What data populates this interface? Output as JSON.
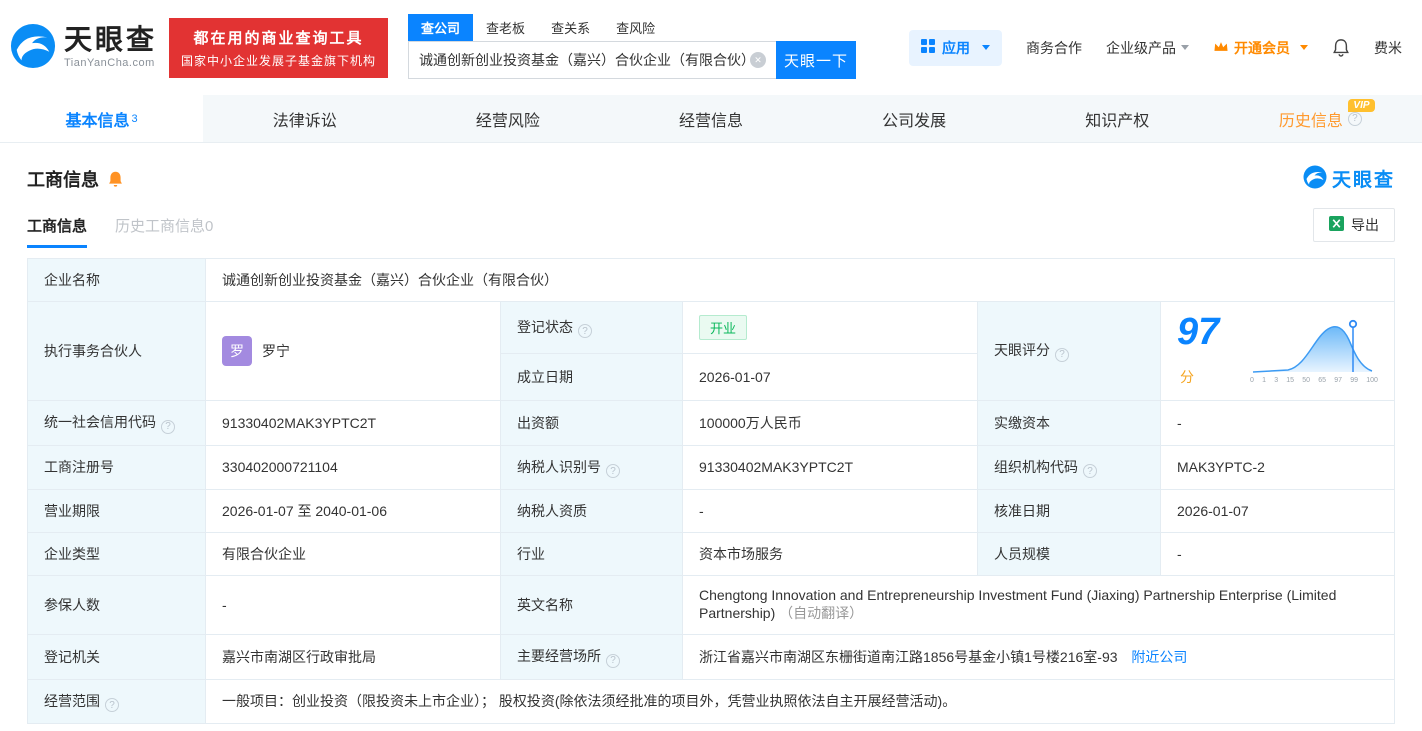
{
  "header": {
    "logo": {
      "name": "天眼查",
      "domain": "TianYanCha.com"
    },
    "banner": {
      "line1": "都在用的商业查询工具",
      "line2": "国家中小企业发展子基金旗下机构"
    },
    "search": {
      "tabs": [
        {
          "label": "查公司"
        },
        {
          "label": "查老板"
        },
        {
          "label": "查关系"
        },
        {
          "label": "查风险"
        }
      ],
      "value": "诚通创新创业投资基金（嘉兴）合伙企业（有限合伙）",
      "button": "天眼一下"
    },
    "menu": {
      "app": "应用",
      "cooperation": "商务合作",
      "enterprise": "企业级产品",
      "vip": "开通会员",
      "user": "费米"
    }
  },
  "nav": {
    "tabs": [
      {
        "label": "基本信息",
        "badge": "3"
      },
      {
        "label": "法律诉讼"
      },
      {
        "label": "经营风险"
      },
      {
        "label": "经营信息"
      },
      {
        "label": "公司发展"
      },
      {
        "label": "知识产权"
      },
      {
        "label": "历史信息",
        "vip": "VIP"
      }
    ]
  },
  "section": {
    "title": "工商信息",
    "brand": "天眼查",
    "tabs": [
      {
        "label": "工商信息"
      },
      {
        "label": "历史工商信息0"
      }
    ],
    "export_label": "导出"
  },
  "info": {
    "company_name": {
      "label": "企业名称",
      "value": "诚通创新创业投资基金（嘉兴）合伙企业（有限合伙）"
    },
    "partner": {
      "label": "执行事务合伙人",
      "avatar": "罗",
      "name": "罗宁"
    },
    "reg_status": {
      "label": "登记状态",
      "value": "开业"
    },
    "establish_date": {
      "label": "成立日期",
      "value": "2026-01-07"
    },
    "score": {
      "label": "天眼评分",
      "value": "97",
      "unit": "分",
      "axis": [
        "0",
        "1",
        "3",
        "15",
        "50",
        "65",
        "97",
        "99",
        "100"
      ]
    },
    "credit_code": {
      "label": "统一社会信用代码",
      "value": "91330402MAK3YPTC2T"
    },
    "capital": {
      "label": "出资额",
      "value": "100000万人民币"
    },
    "paid_capital": {
      "label": "实缴资本",
      "value": "-"
    },
    "reg_number": {
      "label": "工商注册号",
      "value": "330402000721104"
    },
    "taxpayer_id": {
      "label": "纳税人识别号",
      "value": "91330402MAK3YPTC2T"
    },
    "org_code": {
      "label": "组织机构代码",
      "value": "MAK3YPTC-2"
    },
    "business_term": {
      "label": "营业期限",
      "value": "2026-01-07 至 2040-01-06"
    },
    "taxpayer_quality": {
      "label": "纳税人资质",
      "value": "-"
    },
    "approval_date": {
      "label": "核准日期",
      "value": "2026-01-07"
    },
    "company_type": {
      "label": "企业类型",
      "value": "有限合伙企业"
    },
    "industry": {
      "label": "行业",
      "value": "资本市场服务"
    },
    "staff_size": {
      "label": "人员规模",
      "value": "-"
    },
    "insured_count": {
      "label": "参保人数",
      "value": "-"
    },
    "english_name": {
      "label": "英文名称",
      "value": "Chengtong Innovation and Entrepreneurship Investment Fund (Jiaxing) Partnership Enterprise (Limited Partnership)",
      "note": "（自动翻译）"
    },
    "registry": {
      "label": "登记机关",
      "value": "嘉兴市南湖区行政审批局"
    },
    "address": {
      "label": "主要经营场所",
      "value": "浙江省嘉兴市南湖区东栅街道南江路1856号基金小镇1号楼216室-93",
      "link": "附近公司"
    },
    "business_scope": {
      "label": "经营范围",
      "value": "一般项目：创业投资（限投资未上市企业）； 股权投资(除依法须经批准的项目外，凭营业执照依法自主开展经营活动)。"
    }
  },
  "colors": {
    "brand_blue": "#0a84ff",
    "banner_red": "#e23333",
    "vip_orange": "#ff8a00",
    "history_orange": "#ff9a2e",
    "status_green": "#0bb85c",
    "label_bg": "#eef8fc",
    "avatar_purple": "#a38ae0"
  }
}
